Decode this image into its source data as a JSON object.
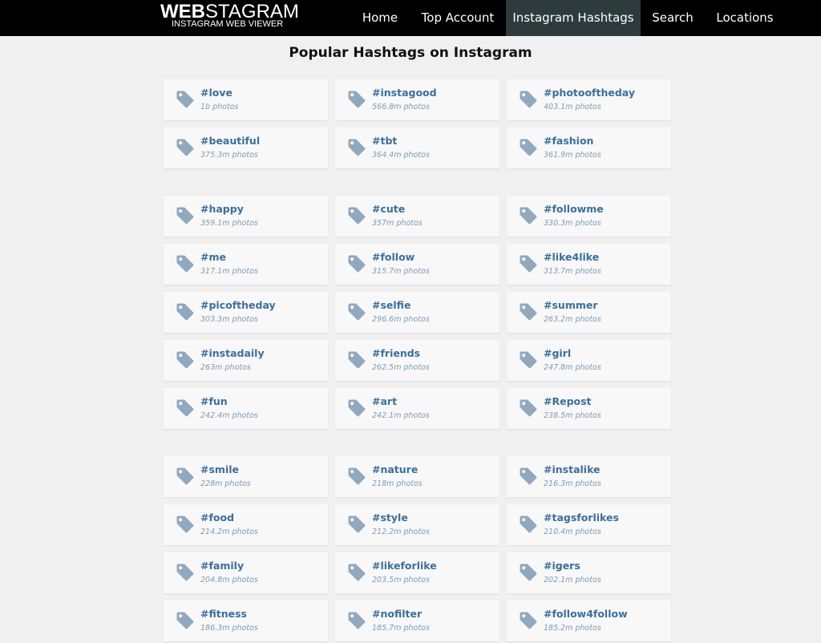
{
  "logo": {
    "bold": "WEB",
    "light": "STAGRAM",
    "subtitle": "INSTAGRAM WEB VIEWER"
  },
  "nav": [
    {
      "label": "Home",
      "active": false
    },
    {
      "label": "Top Account",
      "active": false
    },
    {
      "label": "Instagram Hashtags",
      "active": true
    },
    {
      "label": "Search",
      "active": false
    },
    {
      "label": "Locations",
      "active": false
    }
  ],
  "title": "Popular Hashtags on Instagram",
  "colors": {
    "accent": "#3d6e9a",
    "icon": "#91a8be",
    "active_nav": "#2e3b3d"
  },
  "groups": [
    [
      {
        "tag": "#love",
        "count": "1b photos"
      },
      {
        "tag": "#instagood",
        "count": "566.8m photos"
      },
      {
        "tag": "#photooftheday",
        "count": "403.1m photos"
      },
      {
        "tag": "#beautiful",
        "count": "375.3m photos"
      },
      {
        "tag": "#tbt",
        "count": "364.4m photos"
      },
      {
        "tag": "#fashion",
        "count": "361.9m photos"
      }
    ],
    [
      {
        "tag": "#happy",
        "count": "359.1m photos"
      },
      {
        "tag": "#cute",
        "count": "357m photos"
      },
      {
        "tag": "#followme",
        "count": "330.3m photos"
      },
      {
        "tag": "#me",
        "count": "317.1m photos"
      },
      {
        "tag": "#follow",
        "count": "315.7m photos"
      },
      {
        "tag": "#like4like",
        "count": "313.7m photos"
      },
      {
        "tag": "#picoftheday",
        "count": "303.3m photos"
      },
      {
        "tag": "#selfie",
        "count": "296.6m photos"
      },
      {
        "tag": "#summer",
        "count": "263.2m photos"
      },
      {
        "tag": "#instadaily",
        "count": "263m photos"
      },
      {
        "tag": "#friends",
        "count": "262.5m photos"
      },
      {
        "tag": "#girl",
        "count": "247.8m photos"
      },
      {
        "tag": "#fun",
        "count": "242.4m photos"
      },
      {
        "tag": "#art",
        "count": "242.1m photos"
      },
      {
        "tag": "#Repost",
        "count": "238.5m photos"
      }
    ],
    [
      {
        "tag": "#smile",
        "count": "228m photos"
      },
      {
        "tag": "#nature",
        "count": "218m photos"
      },
      {
        "tag": "#instalike",
        "count": "216.3m photos"
      },
      {
        "tag": "#food",
        "count": "214.2m photos"
      },
      {
        "tag": "#style",
        "count": "212.2m photos"
      },
      {
        "tag": "#tagsforlikes",
        "count": "210.4m photos"
      },
      {
        "tag": "#family",
        "count": "204.8m photos"
      },
      {
        "tag": "#likeforlike",
        "count": "203.5m photos"
      },
      {
        "tag": "#igers",
        "count": "202.1m photos"
      },
      {
        "tag": "#fitness",
        "count": "186.3m photos"
      },
      {
        "tag": "#nofilter",
        "count": "185.7m photos"
      },
      {
        "tag": "#follow4follow",
        "count": "185.2m photos"
      }
    ]
  ]
}
